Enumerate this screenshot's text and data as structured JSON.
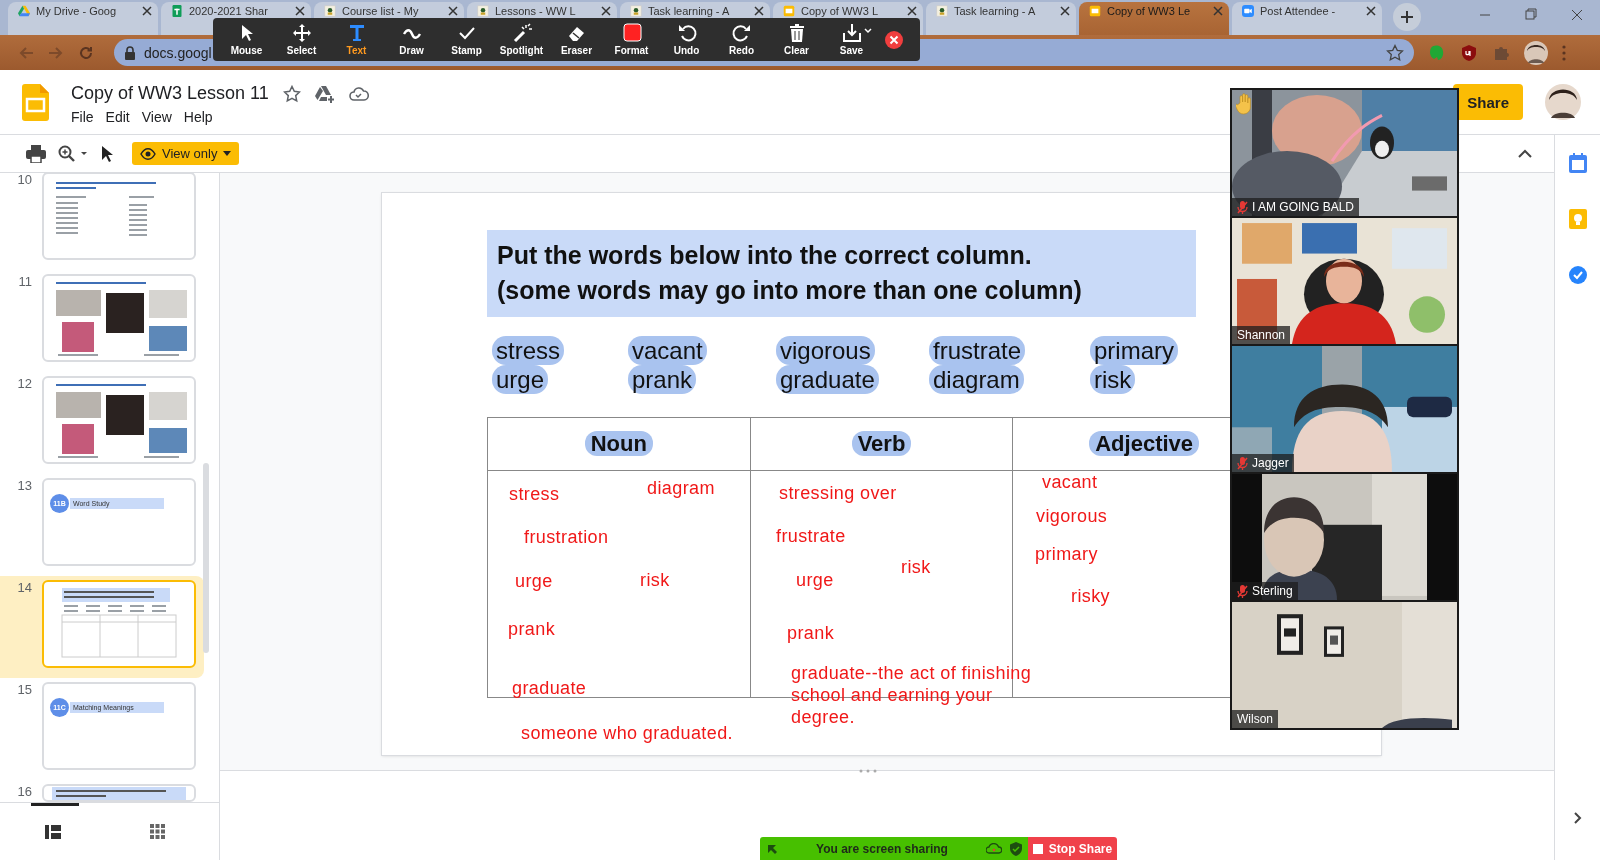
{
  "browser": {
    "tabs": [
      {
        "title": "My Drive - Goog",
        "kind": "drive",
        "selected": false
      },
      {
        "title": "2020-2021 Shar",
        "kind": "sheets",
        "selected": false
      },
      {
        "title": "Course list - My",
        "kind": "site",
        "selected": false
      },
      {
        "title": "Lessons - WW L",
        "kind": "site",
        "selected": false
      },
      {
        "title": "Task learning - A",
        "kind": "site",
        "selected": false
      },
      {
        "title": "Copy of WW3 L",
        "kind": "slides",
        "selected": false
      },
      {
        "title": "Task learning - A",
        "kind": "site",
        "selected": false
      },
      {
        "title": "Copy of WW3 Le",
        "kind": "slides",
        "selected": true
      },
      {
        "title": "Post Attendee -",
        "kind": "zoom",
        "selected": false
      }
    ],
    "url": "docs.googl"
  },
  "annotation_toolbar": {
    "tools": [
      {
        "label": "Mouse",
        "kind": "mouse",
        "selected": false
      },
      {
        "label": "Select",
        "kind": "select",
        "selected": false
      },
      {
        "label": "Text",
        "kind": "text",
        "selected": true
      },
      {
        "label": "Draw",
        "kind": "draw",
        "selected": false
      },
      {
        "label": "Stamp",
        "kind": "stamp",
        "selected": false
      },
      {
        "label": "Spotlight",
        "kind": "spotlight",
        "selected": false
      },
      {
        "label": "Eraser",
        "kind": "eraser",
        "selected": false
      },
      {
        "label": "Format",
        "kind": "format",
        "selected": false
      },
      {
        "label": "Undo",
        "kind": "undo",
        "selected": false
      },
      {
        "label": "Redo",
        "kind": "redo",
        "selected": false
      },
      {
        "label": "Clear",
        "kind": "clear",
        "selected": false
      },
      {
        "label": "Save",
        "kind": "save",
        "selected": false
      }
    ]
  },
  "document": {
    "title": "Copy of WW3 Lesson 11",
    "menus": [
      "File",
      "Edit",
      "View",
      "Help"
    ],
    "share_label": "Share",
    "mode_label": "View only"
  },
  "thumbnails": [
    {
      "number": "10",
      "kind": "text",
      "selected": false
    },
    {
      "number": "11",
      "kind": "photos",
      "selected": false
    },
    {
      "number": "12",
      "kind": "photos",
      "selected": false
    },
    {
      "number": "13",
      "kind": "section",
      "badge": "11B",
      "title": "Word Study",
      "selected": false
    },
    {
      "number": "14",
      "kind": "table",
      "selected": true
    },
    {
      "number": "15",
      "kind": "section",
      "badge": "11C",
      "title": "Matching Meanings",
      "selected": false
    },
    {
      "number": "16",
      "kind": "heading",
      "selected": false
    }
  ],
  "slide": {
    "title_lines": [
      "Put the words below into the correct column.",
      "(some words may go into more than one column)"
    ],
    "word_bank": [
      [
        "stress",
        "vacant",
        "vigorous",
        "frustrate",
        "primary"
      ],
      [
        "urge",
        "prank",
        "graduate",
        "diagram",
        "risk"
      ]
    ],
    "columns": [
      {
        "heading": "Noun",
        "notes": [
          "stress",
          "diagram",
          "frustration",
          "urge",
          "risk",
          "prank",
          "graduate",
          "someone who graduated."
        ]
      },
      {
        "heading": "Verb",
        "notes": [
          "stressing over",
          "frustrate",
          "risk",
          "urge",
          "prank",
          "graduate--the act of finishing school and earning your degree."
        ]
      },
      {
        "heading": "Adjective",
        "notes": [
          "vacant",
          "vigorous",
          "primary",
          "risky"
        ]
      }
    ]
  },
  "participants": [
    {
      "name": "I AM GOING BALD",
      "muted": true,
      "hand_raised": true
    },
    {
      "name": "Shannon",
      "muted": false,
      "hand_raised": false
    },
    {
      "name": "Jagger",
      "muted": true,
      "hand_raised": false
    },
    {
      "name": "Sterling",
      "muted": true,
      "hand_raised": false
    },
    {
      "name": "Wilson",
      "muted": false,
      "hand_raised": false
    }
  ],
  "share_bar": {
    "status": "You are screen sharing",
    "stop_label": "Stop Share"
  }
}
